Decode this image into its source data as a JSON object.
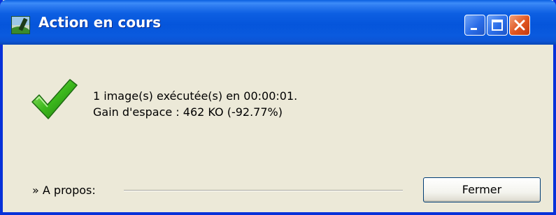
{
  "window": {
    "title": "Action en cours",
    "buttons": [
      "minimize",
      "maximize",
      "close"
    ]
  },
  "message": {
    "icon": "checkmark-icon",
    "line1": "1 image(s) exécutée(s) en 00:00:01.",
    "line2": "Gain d'espace : 462 KO (-92.77%)"
  },
  "footer": {
    "about_label": "» A propos:",
    "close_label": "Fermer"
  },
  "colors": {
    "titlebar": "#0555db",
    "frame": "#0831d9",
    "background": "#ece9d8",
    "check": "#3cb81c",
    "close_button": "#e0541e"
  }
}
